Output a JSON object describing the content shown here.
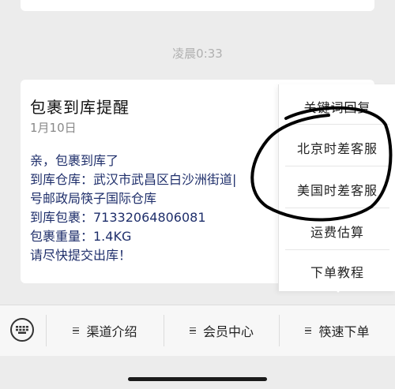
{
  "chat": {
    "timestamp": "凌晨0:33",
    "message": {
      "title": "包裹到库提醒",
      "date": "1月10日",
      "lines": [
        "亲，包裹到库了",
        "到库仓库：武汉市武昌区白沙洲街道|",
        "号邮政局筷子国际仓库",
        "到库包裹：71332064806081",
        "包裹重量：1.4KG",
        "请尽快提交出库！"
      ]
    }
  },
  "popup_menu": {
    "items": [
      "关键词回复",
      "北京时差客服",
      "美国时差客服",
      "运费估算",
      "下单教程"
    ]
  },
  "tabbar": {
    "tabs": [
      "渠道介绍",
      "会员中心",
      "筷速下单"
    ]
  },
  "icons": {
    "keyboard": "keyboard-icon",
    "menu": "menu-lines-icon"
  },
  "colors": {
    "message_text": "#1f2f6b",
    "annotation": "#000000"
  }
}
